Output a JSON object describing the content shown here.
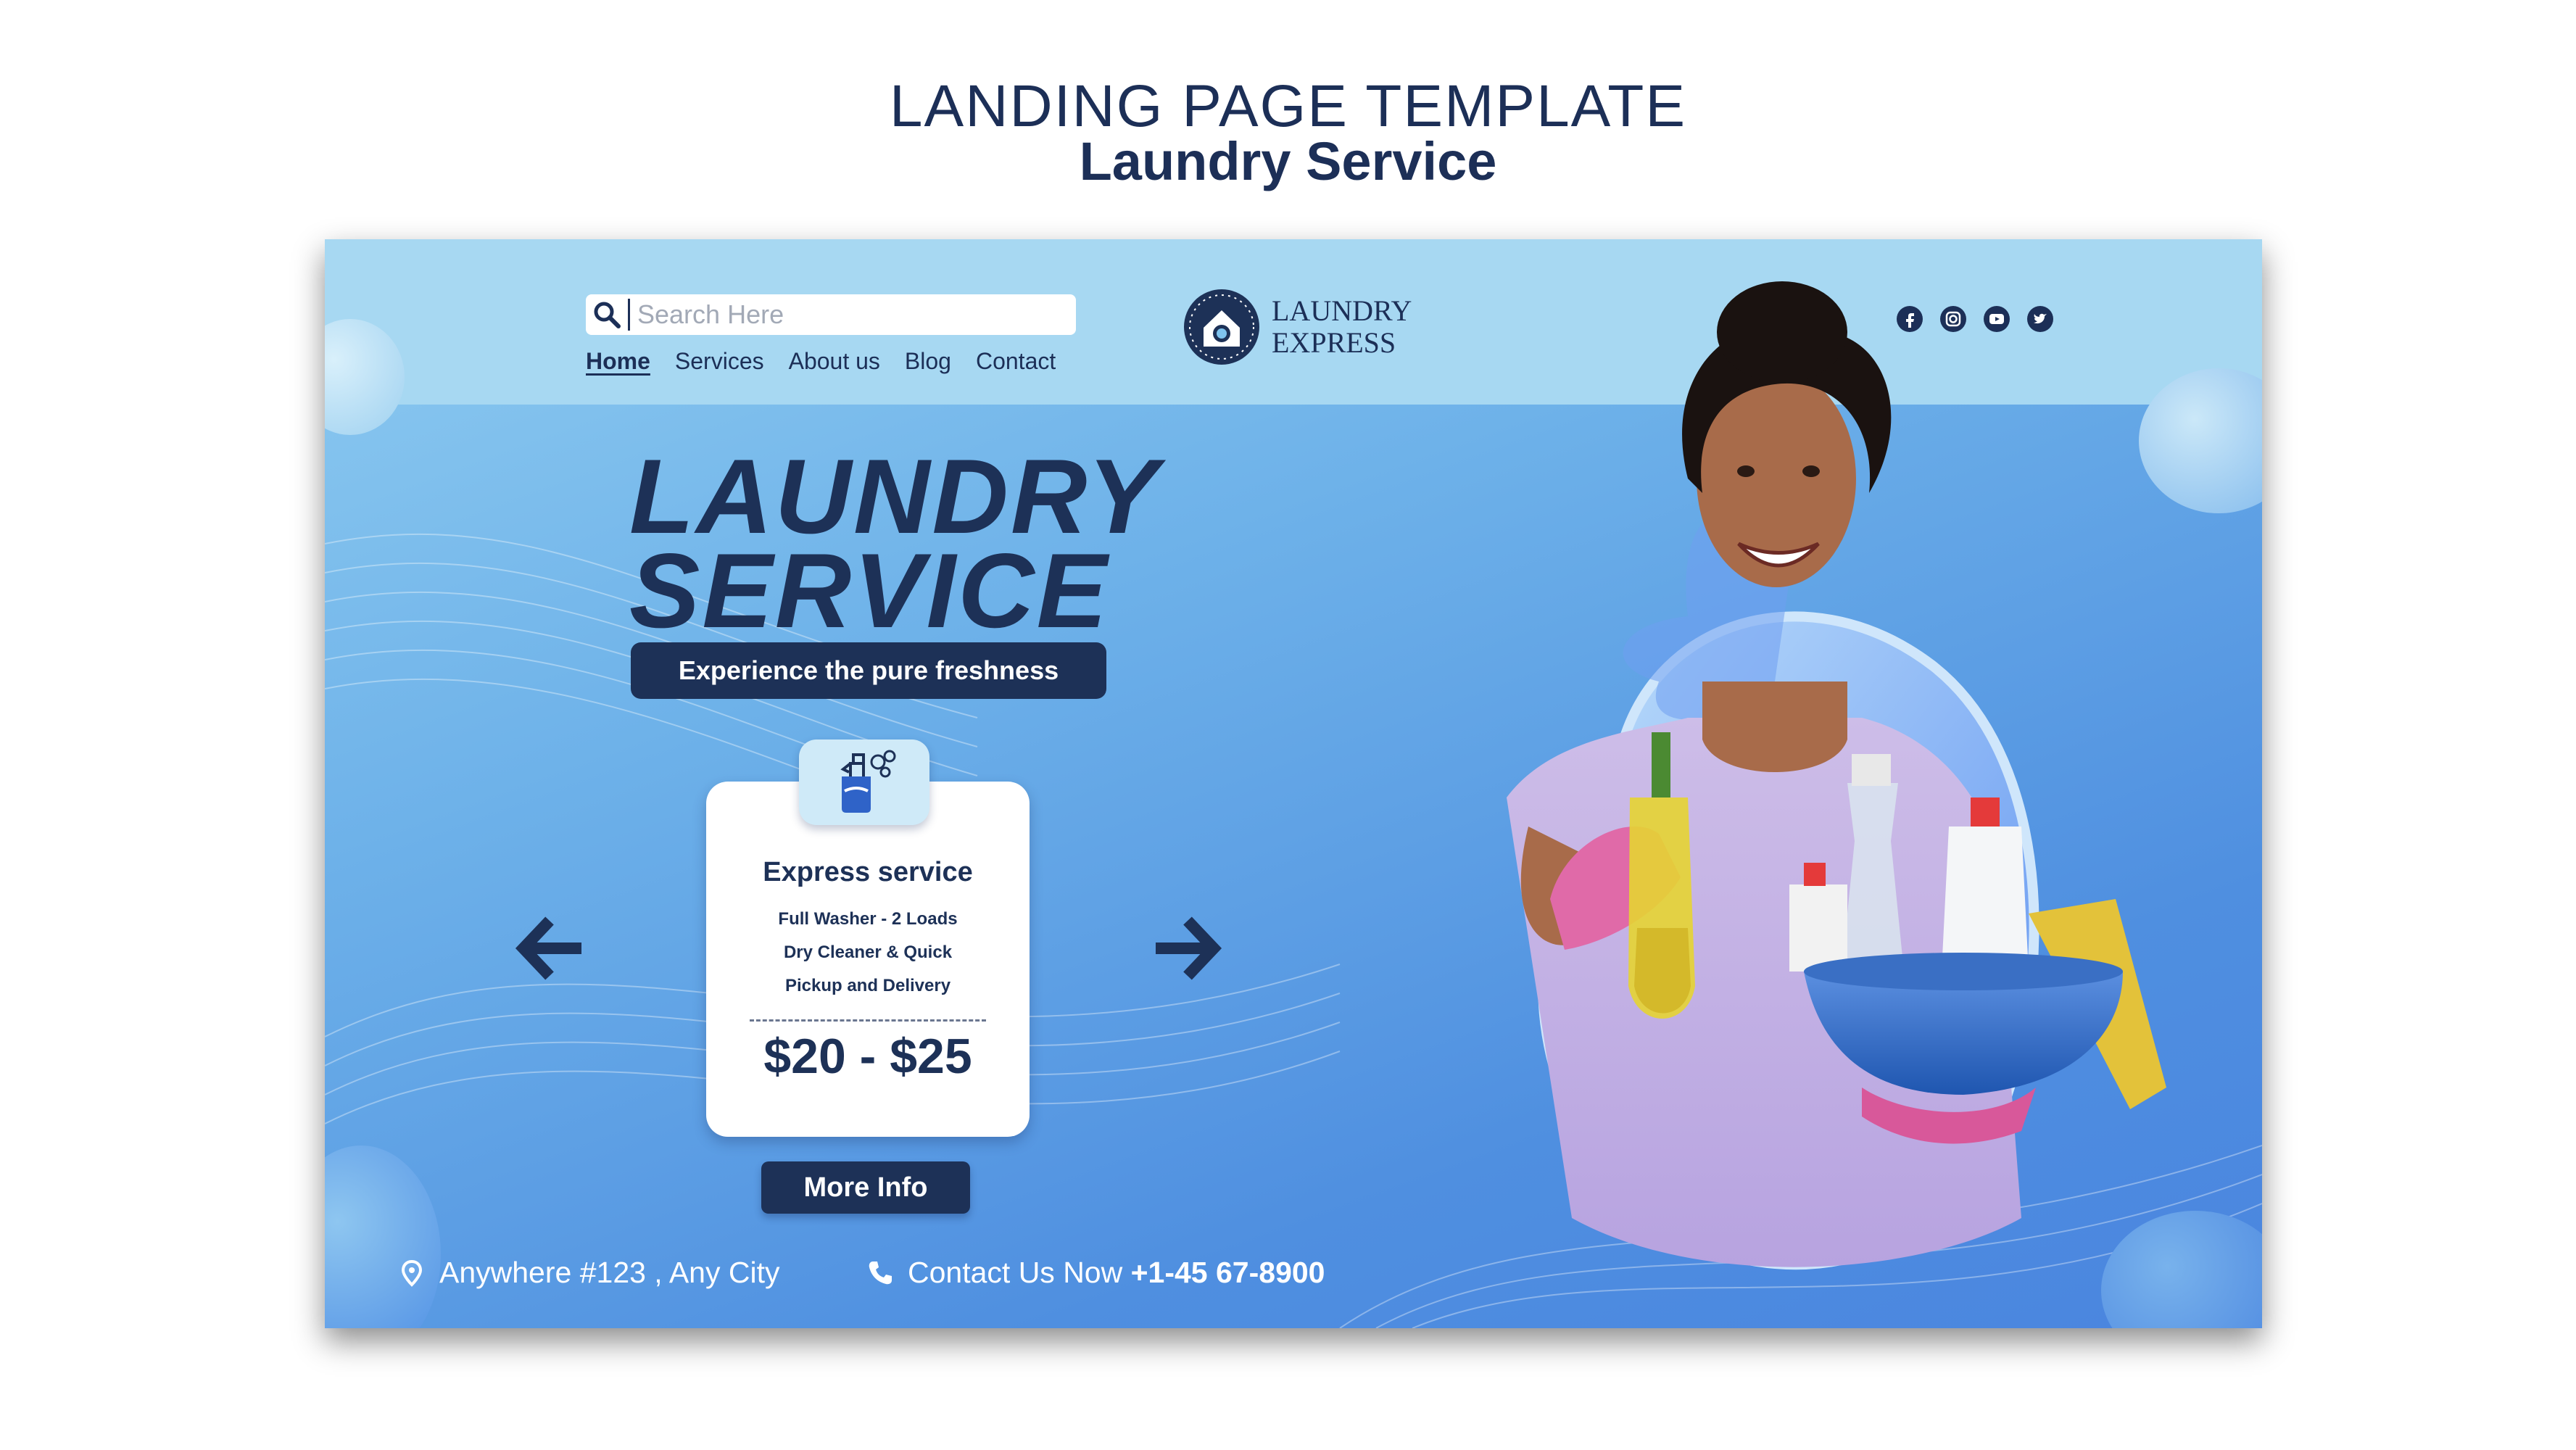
{
  "template_heading": {
    "line1": "LANDING PAGE TEMPLATE",
    "line2": "Laundry Service"
  },
  "header": {
    "search": {
      "placeholder": "Search Here"
    },
    "nav": [
      "Home",
      "Services",
      "About us",
      "Blog",
      "Contact"
    ],
    "active_nav": "Home",
    "logo": {
      "line1": "LAUNDRY",
      "line2": "EXPRESS"
    },
    "social_icons": [
      "facebook-icon",
      "instagram-icon",
      "youtube-icon",
      "twitter-icon"
    ]
  },
  "hero": {
    "title_line1": "LAUNDRY",
    "title_line2": "SERVICE",
    "tagline": "Experience the pure freshness"
  },
  "service_card": {
    "icon": "spray-bottle-icon",
    "title": "Express service",
    "features": [
      "Full Washer - 2 Loads",
      "Dry Cleaner & Quick",
      "Pickup and Delivery"
    ],
    "price": "$20 - $25",
    "button": "More Info"
  },
  "footer": {
    "address": "Anywhere #123 , Any City",
    "contact_label": "Contact Us Now ",
    "phone": "+1-45 67-8900"
  },
  "colors": {
    "navy": "#1d3157",
    "header_band": "#a7d8f2",
    "card_icon_bg": "#cfeaf8",
    "background_light": "#8ecbf0",
    "background_dark": "#4a85df"
  }
}
